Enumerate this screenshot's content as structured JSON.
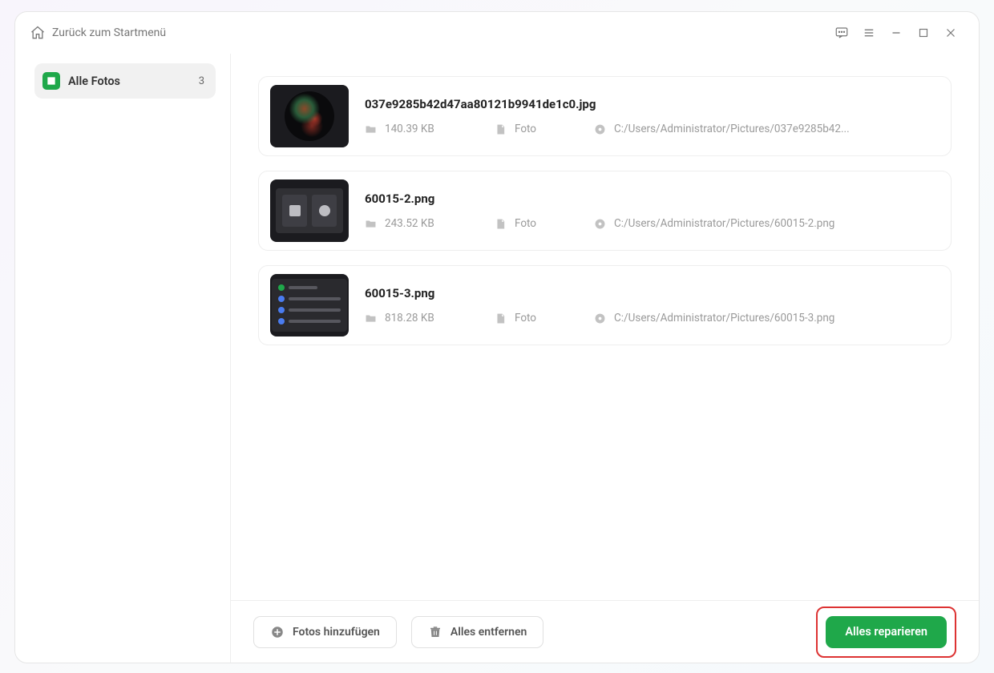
{
  "header": {
    "back_label": "Zurück zum Startmenü"
  },
  "sidebar": {
    "all_photos_label": "Alle Fotos",
    "count": "3"
  },
  "files": [
    {
      "name": "037e9285b42d47aa80121b9941de1c0.jpg",
      "size": "140.39 KB",
      "type": "Foto",
      "path": "C:/Users/Administrator/Pictures/037e9285b42..."
    },
    {
      "name": "60015-2.png",
      "size": "243.52 KB",
      "type": "Foto",
      "path": "C:/Users/Administrator/Pictures/60015-2.png"
    },
    {
      "name": "60015-3.png",
      "size": "818.28 KB",
      "type": "Foto",
      "path": "C:/Users/Administrator/Pictures/60015-3.png"
    }
  ],
  "footer": {
    "add_label": "Fotos hinzufügen",
    "remove_label": "Alles entfernen",
    "repair_label": "Alles reparieren"
  }
}
